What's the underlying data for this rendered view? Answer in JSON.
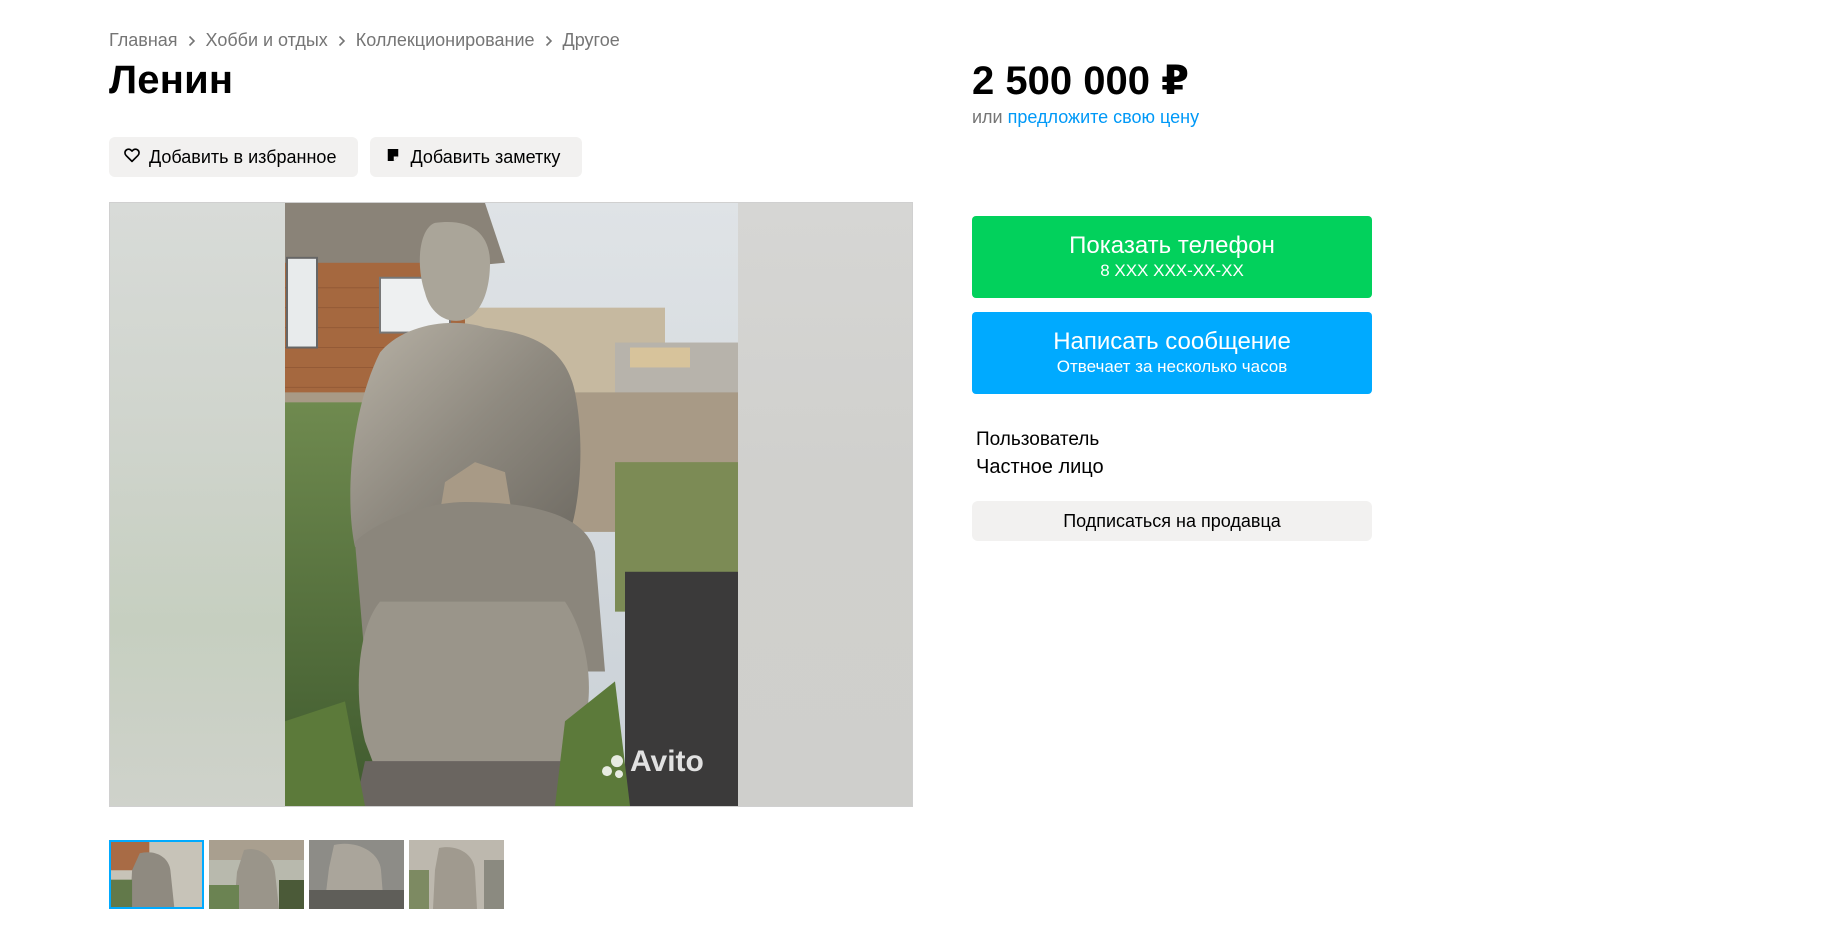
{
  "breadcrumbs": [
    "Главная",
    "Хобби и отдых",
    "Коллекционирование",
    "Другое"
  ],
  "listing": {
    "title": "Ленин",
    "price": "2 500 000 ₽",
    "offer_prefix": "или",
    "offer_link": "предложите свою цену"
  },
  "actions": {
    "favorite_label": "Добавить в избранное",
    "note_label": "Добавить заметку"
  },
  "gallery": {
    "watermark": "Avito",
    "thumbnail_count": 4,
    "active_thumbnail": 0
  },
  "contact": {
    "phone_label": "Показать телефон",
    "phone_masked": "8 XXX XXX-XX-XX",
    "message_label": "Написать сообщение",
    "message_sub": "Отвечает за несколько часов"
  },
  "seller": {
    "name": "Пользователь",
    "type": "Частное лицо",
    "subscribe_label": "Подписаться на продавца"
  },
  "colors": {
    "green": "#02d15c",
    "blue": "#00aaff",
    "link": "#0099f7",
    "pill_bg": "#f2f1f0"
  }
}
